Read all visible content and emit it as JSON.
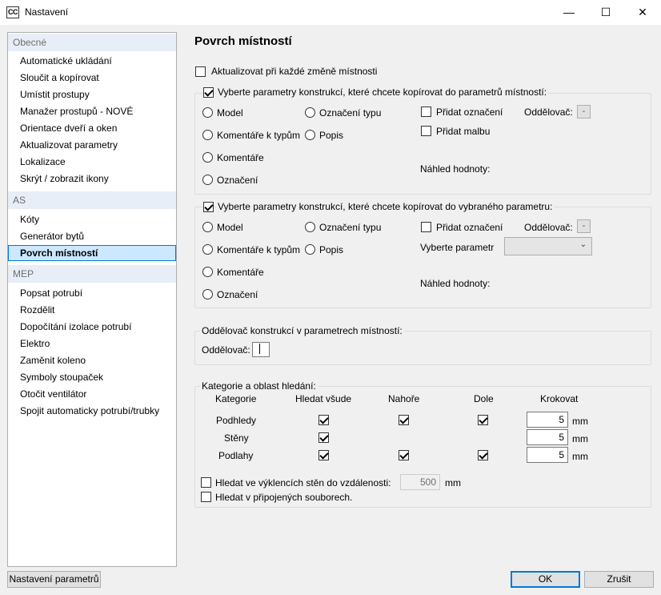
{
  "window": {
    "app_icon": "CC",
    "title": "Nastavení",
    "minimize": "—",
    "maximize": "☐",
    "close": "✕"
  },
  "sidebar": {
    "groups": [
      {
        "header": "Obecné",
        "items": [
          "Automatické ukládání",
          "Sloučit a kopírovat",
          "Umístit prostupy",
          "Manažer prostupů - NOVÉ",
          "Orientace dveří a oken",
          "Aktualizovat parametry",
          "Lokalizace",
          "Skrýt / zobrazit ikony"
        ]
      },
      {
        "header": "AS",
        "items": [
          "Kóty",
          "Generátor bytů",
          "Povrch místností"
        ]
      },
      {
        "header": "MEP",
        "items": [
          "Popsat potrubí",
          "Rozdělit",
          "Dopočítání izolace potrubí",
          "Elektro",
          "Zaměnit koleno",
          "Symboly stoupaček",
          "Otočit ventilátor",
          "Spojit automaticky potrubí/trubky"
        ]
      }
    ],
    "selected": "Povrch místností"
  },
  "content": {
    "title": "Povrch místností",
    "update_each_change": {
      "label": "Aktualizovat při každé změně místnosti",
      "checked": false
    },
    "section1": {
      "label": "Vyberte parametry konstrukcí, které chcete kopírovat do parametrů místností:",
      "checked": true,
      "radios": [
        "Model",
        "Označení typu",
        "Komentáře k typům",
        "Popis",
        "Komentáře",
        "Označení"
      ],
      "add_mark": "Přidat označení",
      "add_paint": "Přidat malbu",
      "separator_label": "Oddělovač:",
      "separator_btn": "-",
      "preview_label": "Náhled hodnoty:"
    },
    "section2": {
      "label": "Vyberte parametry konstrukcí, které chcete kopírovat do vybraného parametru:",
      "checked": true,
      "radios": [
        "Model",
        "Označení typu",
        "Komentáře k typům",
        "Popis",
        "Komentáře",
        "Označení"
      ],
      "add_mark": "Přidat označení",
      "separator_label": "Oddělovač:",
      "separator_btn": "-",
      "select_param_label": "Vyberte parametr",
      "select_param_value": "",
      "preview_label": "Náhled hodnoty:"
    },
    "section3": {
      "legend": "Oddělovač konstrukcí v parametrech místností:",
      "separator_label": "Oddělovač:",
      "separator_value": ""
    },
    "section4": {
      "legend": "Kategorie a oblast hledání:",
      "headers": [
        "Kategorie",
        "Hledat všude",
        "Nahoře",
        "Dole",
        "Krokovat"
      ],
      "rows": [
        {
          "name": "Podhledy",
          "everywhere": true,
          "top": true,
          "bottom": true,
          "step": "5",
          "unit": "mm"
        },
        {
          "name": "Stěny",
          "everywhere": true,
          "top": null,
          "bottom": null,
          "step": "5",
          "unit": "mm"
        },
        {
          "name": "Podlahy",
          "everywhere": true,
          "top": true,
          "bottom": true,
          "step": "5",
          "unit": "mm"
        }
      ],
      "recess_label": "Hledat ve výklencích stěn do vzdálenosti:",
      "recess_value": "500",
      "recess_unit": "mm",
      "linked_label": "Hledat v připojených souborech."
    }
  },
  "footer": {
    "param_settings": "Nastavení parametrů",
    "ok": "OK",
    "cancel": "Zrušit"
  }
}
